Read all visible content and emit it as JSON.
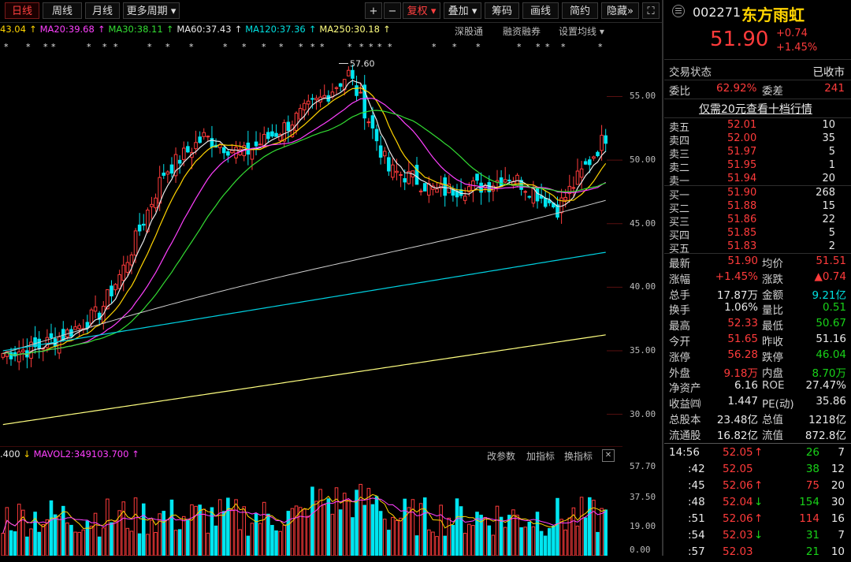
{
  "toolbar": {
    "left_tabs": [
      "日线",
      "周线",
      "月线",
      "更多周期"
    ],
    "right_buttons": [
      "+",
      "−",
      "复权",
      "叠加",
      "筹码",
      "画线",
      "简约",
      "隐藏"
    ],
    "collapse_arrows": "»",
    "close": "⛶"
  },
  "ma_legend": {
    "items": [
      {
        "text": "43.04",
        "color": "#ffd400"
      },
      {
        "text": "MA20:39.68",
        "color": "#ff40ff"
      },
      {
        "text": "MA30:38.11",
        "color": "#33dd33"
      },
      {
        "text": "MA60:37.43",
        "color": "#e8e8e8"
      },
      {
        "text": "MA120:37.36",
        "color": "#00e0e0"
      },
      {
        "text": "MA250:30.18",
        "color": "#ffff80"
      }
    ],
    "links": [
      "深股通",
      "融资融券",
      "设置均线"
    ]
  },
  "price_axis": [
    "55.00",
    "50.00",
    "45.00",
    "40.00",
    "35.00",
    "30.00"
  ],
  "high_marker": "57.60",
  "volume": {
    "header_left": ".400",
    "header_mavol": "MAVOL2:349103.700",
    "links": [
      "改参数",
      "加指标",
      "换指标"
    ],
    "close": "✕",
    "axis": [
      "57.70",
      "37.50",
      "19.00",
      "0.00"
    ]
  },
  "stock": {
    "code": "002271",
    "name": "东方雨虹",
    "price": "51.90",
    "change": "+0.74",
    "change_pct": "+1.45%"
  },
  "status": {
    "label": "交易状态",
    "value": "已收市"
  },
  "weibi": {
    "label1": "委比",
    "value1": "62.92%",
    "label2": "委差",
    "value2": "241"
  },
  "promo": "仅需20元查看十档行情",
  "asks": [
    {
      "label": "卖五",
      "price": "52.01",
      "vol": "10"
    },
    {
      "label": "卖四",
      "price": "52.00",
      "vol": "35"
    },
    {
      "label": "卖三",
      "price": "51.97",
      "vol": "5"
    },
    {
      "label": "卖二",
      "price": "51.95",
      "vol": "1"
    },
    {
      "label": "卖一",
      "price": "51.94",
      "vol": "20"
    }
  ],
  "bids": [
    {
      "label": "买一",
      "price": "51.90",
      "vol": "268"
    },
    {
      "label": "买二",
      "price": "51.88",
      "vol": "15"
    },
    {
      "label": "买三",
      "price": "51.86",
      "vol": "22"
    },
    {
      "label": "买四",
      "price": "51.85",
      "vol": "5"
    },
    {
      "label": "买五",
      "price": "51.83",
      "vol": "2"
    }
  ],
  "quote": [
    {
      "l1": "最新",
      "v1": "51.90",
      "c1": "red",
      "l2": "均价",
      "v2": "51.51",
      "c2": "red"
    },
    {
      "l1": "涨幅",
      "v1": "+1.45%",
      "c1": "red",
      "l2": "涨跌",
      "v2": "▲0.74",
      "c2": "red"
    },
    {
      "l1": "总手",
      "v1": "17.87万",
      "c1": "white",
      "l2": "金额",
      "v2": "9.21亿",
      "c2": "cyan"
    },
    {
      "l1": "换手",
      "v1": "1.06%",
      "c1": "white",
      "l2": "量比",
      "v2": "0.51",
      "c2": "green"
    },
    {
      "l1": "最高",
      "v1": "52.33",
      "c1": "red",
      "l2": "最低",
      "v2": "50.67",
      "c2": "green"
    },
    {
      "l1": "今开",
      "v1": "51.65",
      "c1": "red",
      "l2": "昨收",
      "v2": "51.16",
      "c2": "white"
    },
    {
      "l1": "涨停",
      "v1": "56.28",
      "c1": "red",
      "l2": "跌停",
      "v2": "46.04",
      "c2": "green"
    },
    {
      "l1": "外盘",
      "v1": "9.18万",
      "c1": "red",
      "l2": "内盘",
      "v2": "8.70万",
      "c2": "green"
    },
    {
      "l1": "净资产",
      "v1": "6.16",
      "c1": "white",
      "l2": "ROE",
      "v2": "27.47%",
      "c2": "white"
    },
    {
      "l1": "收益㈣",
      "v1": "1.447",
      "c1": "white",
      "l2": "PE(动)",
      "v2": "35.86",
      "c2": "white"
    },
    {
      "l1": "总股本",
      "v1": "23.48亿",
      "c1": "white",
      "l2": "总值",
      "v2": "1218亿",
      "c2": "white"
    },
    {
      "l1": "流通股",
      "v1": "16.82亿",
      "c1": "white",
      "l2": "流值",
      "v2": "872.8亿",
      "c2": "white"
    }
  ],
  "ticks": [
    {
      "t": "14:56",
      "p": "52.05",
      "arrow": "↑",
      "v": "26",
      "n": "7",
      "vc": "green"
    },
    {
      "t": ":42",
      "p": "52.05",
      "arrow": "",
      "v": "38",
      "n": "12",
      "vc": "green"
    },
    {
      "t": ":45",
      "p": "52.06",
      "arrow": "↑",
      "v": "75",
      "n": "20",
      "vc": "red"
    },
    {
      "t": ":48",
      "p": "52.04",
      "arrow": "↓",
      "v": "154",
      "n": "30",
      "vc": "green"
    },
    {
      "t": ":51",
      "p": "52.06",
      "arrow": "↑",
      "v": "114",
      "n": "16",
      "vc": "red"
    },
    {
      "t": ":54",
      "p": "52.03",
      "arrow": "↓",
      "v": "31",
      "n": "7",
      "vc": "green"
    },
    {
      "t": ":57",
      "p": "52.03",
      "arrow": "",
      "v": "21",
      "n": "10",
      "vc": "green"
    }
  ],
  "colors": {
    "up": "#ff3b3b",
    "down": "#00e5f0",
    "bg": "#000000"
  }
}
